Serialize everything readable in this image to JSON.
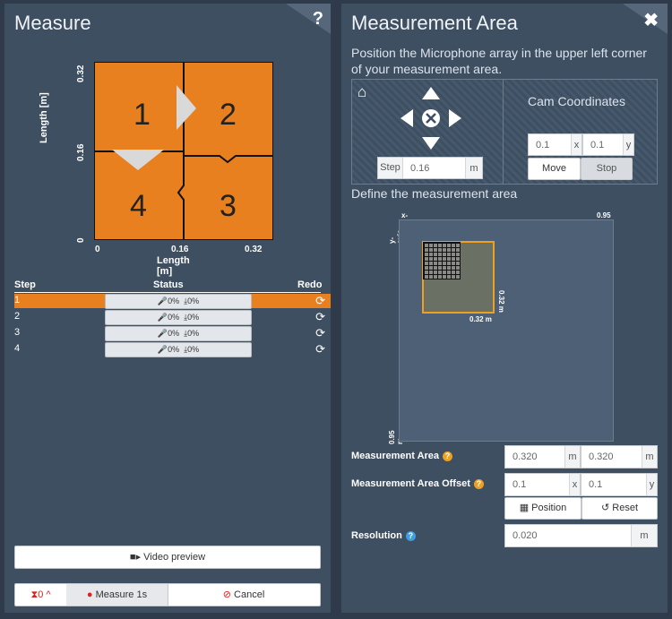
{
  "left": {
    "title": "Measure",
    "help_icon": "?",
    "diagram": {
      "y_label": "Length [m]",
      "x_label": "Length [m]",
      "y_ticks": [
        "0.32",
        "0.16",
        "0"
      ],
      "x_ticks": [
        "0",
        "0.16",
        "0.32"
      ],
      "quadrants": [
        "1",
        "2",
        "3",
        "4"
      ],
      "colors": {
        "fill": "#e8801f",
        "arrow": "#d9d9d9"
      }
    },
    "table": {
      "headers": {
        "step": "Step",
        "status": "Status",
        "redo": "Redo"
      },
      "rows": [
        {
          "step": "1",
          "mic": "0%",
          "download": "0%",
          "active": true
        },
        {
          "step": "2",
          "mic": "0%",
          "download": "0%",
          "active": false
        },
        {
          "step": "3",
          "mic": "0%",
          "download": "0%",
          "active": false
        },
        {
          "step": "4",
          "mic": "0%",
          "download": "0%",
          "active": false
        }
      ]
    },
    "video_preview": "Video preview",
    "timer_count": "0",
    "measure_button": "Measure 1s",
    "cancel_button": "Cancel"
  },
  "right": {
    "title": "Measurement Area",
    "instruction": "Position the Microphone array in the upper left corner of your measurement area.",
    "step_label": "Step",
    "step_value": "0.16",
    "step_unit": "m",
    "cam_title": "Cam Coordinates",
    "cam_x": "0.1",
    "cam_x_unit": "x",
    "cam_y": "0.1",
    "cam_y_unit": "y",
    "move_button": "Move",
    "stop_button": "Stop",
    "define_label": "Define the measurement area",
    "area": {
      "x_axis": "x-axis",
      "y_axis": "y-axis",
      "width_label": "0.95 m",
      "height_label": "0.95 m",
      "rect_w_label": "0.32 m",
      "rect_h_label": "0.32 m"
    },
    "measurement_area_label": "Measurement Area",
    "area_w": "0.320",
    "area_w_unit": "m",
    "area_h": "0.320",
    "area_h_unit": "m",
    "offset_label": "Measurement Area Offset",
    "offset_x": "0.1",
    "offset_x_unit": "x",
    "offset_y": "0.1",
    "offset_y_unit": "y",
    "position_button": "Position",
    "reset_button": "Reset",
    "resolution_label": "Resolution",
    "resolution_value": "0.020",
    "resolution_unit": "m",
    "colors": {
      "accent": "#e8a01f",
      "help_orange": "#f0a020",
      "help_blue": "#3c9ee5"
    }
  }
}
